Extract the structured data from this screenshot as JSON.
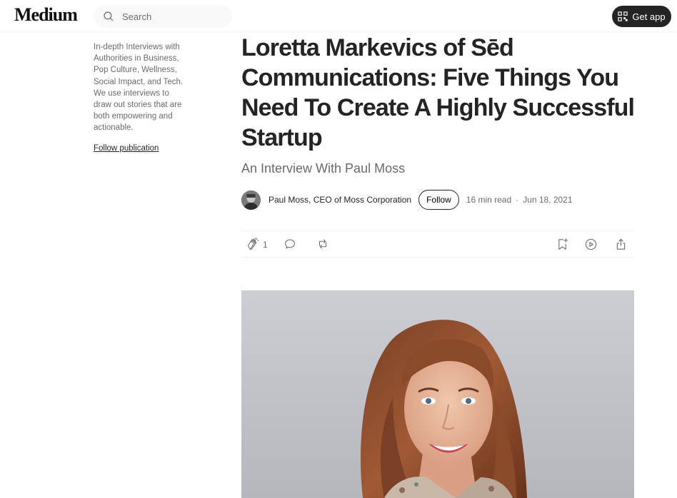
{
  "header": {
    "logo": "Medium",
    "search_placeholder": "Search",
    "get_app_label": "Get app"
  },
  "sidebar": {
    "publication_description": "In-depth Interviews with Authorities in Business, Pop Culture, Wellness, Social Impact, and Tech. We use interviews to draw out stories that are both empowering and actionable.",
    "follow_publication_label": "Follow publication"
  },
  "article": {
    "title": "Loretta Markevics of Sēd Communications: Five Things You Need To Create A Highly Successful Startup",
    "subtitle": "An Interview With Paul Moss",
    "author": "Paul Moss, CEO of Moss Corporation",
    "follow_label": "Follow",
    "read_time": "16 min read",
    "separator": "·",
    "date": "Jun 18, 2021",
    "clap_count": "1"
  },
  "icons": {
    "search": "search-icon",
    "get_app": "qr-code-icon",
    "clap": "clap-icon",
    "response": "comment-icon",
    "repost": "repost-icon",
    "bookmark": "bookmark-add-icon",
    "listen": "play-circle-icon",
    "share": "share-icon"
  },
  "colors": {
    "text_primary": "#242424",
    "text_secondary": "#6b6b6b",
    "button_dark": "#242424"
  }
}
